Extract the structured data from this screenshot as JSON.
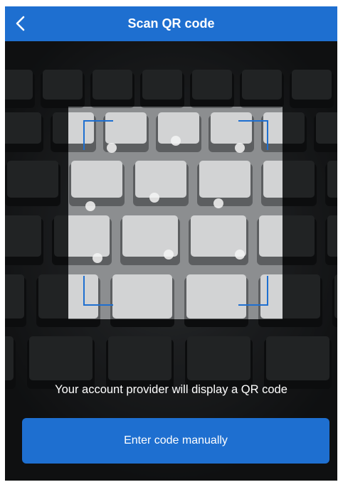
{
  "header": {
    "title": "Scan QR code",
    "back_icon": "chevron-left-icon"
  },
  "scanner": {
    "instruction": "Your account provider will display a QR code",
    "frame_color": "#1e6fd0"
  },
  "actions": {
    "enter_manually_label": "Enter code manually"
  },
  "colors": {
    "accent": "#1e6fd0",
    "text_on_accent": "#ffffff"
  }
}
